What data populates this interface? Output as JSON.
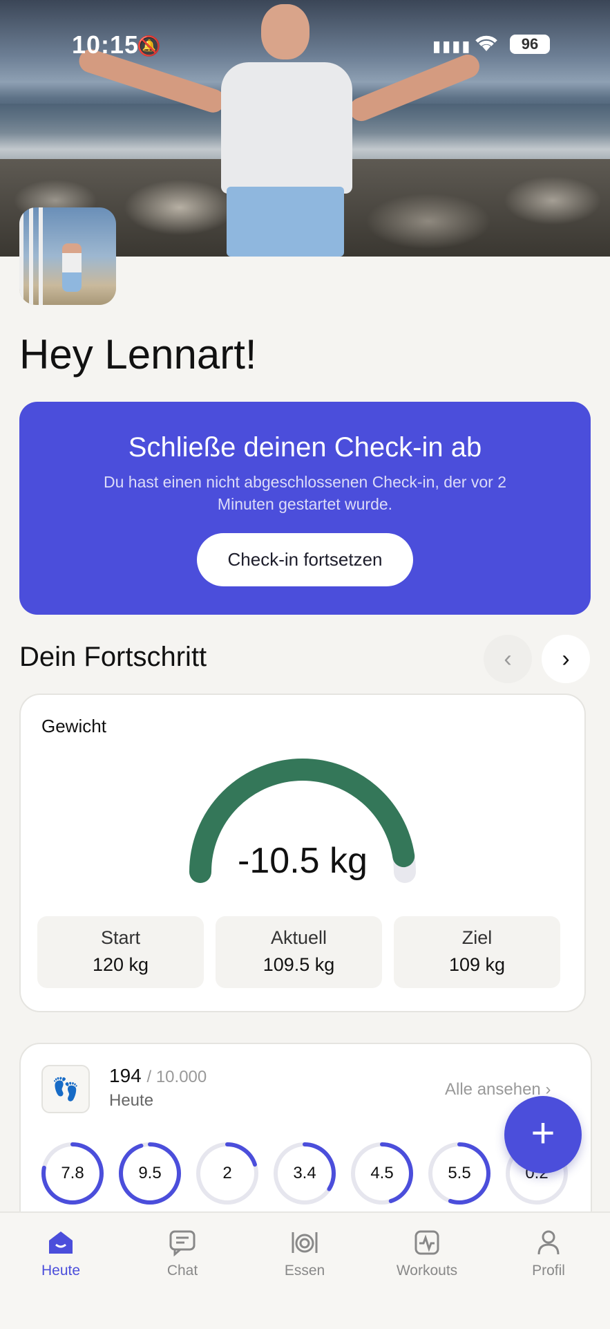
{
  "status_bar": {
    "time": "10:15",
    "battery": "96"
  },
  "greeting": "Hey Lennart!",
  "checkin": {
    "title": "Schließe deinen Check-in ab",
    "subtitle": "Du hast einen nicht abgeschlossenen Check-in, der vor 2 Minuten gestartet wurde.",
    "button": "Check-in fortsetzen"
  },
  "progress": {
    "title": "Dein Fortschritt"
  },
  "weight_card": {
    "label": "Gewicht",
    "delta": "-10.5 kg",
    "fill_fraction": 0.95,
    "stats": [
      {
        "label": "Start",
        "value": "120 kg"
      },
      {
        "label": "Aktuell",
        "value": "109.5 kg"
      },
      {
        "label": "Ziel",
        "value": "109 kg"
      }
    ]
  },
  "steps_card": {
    "steps": "194",
    "goal": "/ 10.000",
    "day": "Heute",
    "see_all": "Alle ansehen",
    "rings": [
      {
        "value": "7.8",
        "fraction": 0.78
      },
      {
        "value": "9.5",
        "fraction": 0.95
      },
      {
        "value": "2",
        "fraction": 0.2
      },
      {
        "value": "3.4",
        "fraction": 0.34
      },
      {
        "value": "4.5",
        "fraction": 0.45
      },
      {
        "value": "5.5",
        "fraction": 0.55
      },
      {
        "value": "0.2",
        "fraction": 0.02
      }
    ]
  },
  "tabs": [
    {
      "label": "Heute",
      "icon": "home-icon"
    },
    {
      "label": "Chat",
      "icon": "chat-icon"
    },
    {
      "label": "Essen",
      "icon": "food-icon"
    },
    {
      "label": "Workouts",
      "icon": "workouts-icon"
    },
    {
      "label": "Profil",
      "icon": "profile-icon"
    }
  ],
  "colors": {
    "accent": "#4b4edb",
    "gauge": "#347759"
  }
}
